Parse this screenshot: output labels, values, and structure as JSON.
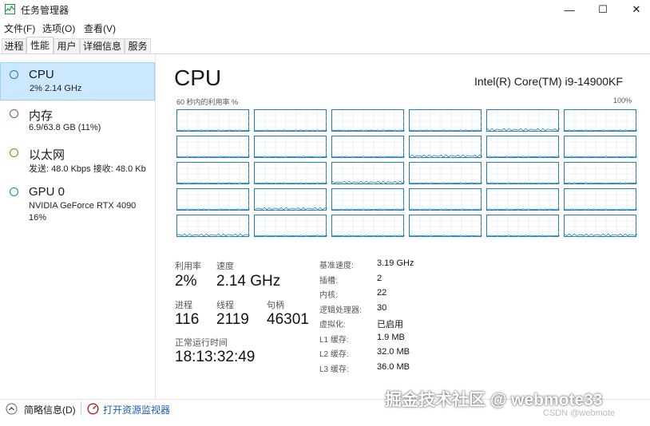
{
  "window": {
    "title": "任务管理器",
    "controls": {
      "minimize": "—",
      "maximize": "☐",
      "close": "✕"
    }
  },
  "menu": [
    "文件(F)",
    "选项(O)",
    "查看(V)"
  ],
  "tabs": [
    "进程",
    "性能",
    "用户",
    "详细信息",
    "服务"
  ],
  "active_tab": "性能",
  "sidebar": {
    "items": [
      {
        "name": "CPU",
        "sub1": "2% 2.14 GHz",
        "sub2": "",
        "ring_color": "#1f7bbf",
        "selected": true
      },
      {
        "name": "内存",
        "sub1": "6.9/63.8 GB (11%)",
        "sub2": "",
        "ring_color": "#8b3fa8",
        "selected": false
      },
      {
        "name": "以太网",
        "sub1": "发送: 48.0 Kbps 接收: 48.0 Kb",
        "sub2": "",
        "ring_color": "#a8721f",
        "selected": false
      },
      {
        "name": "GPU 0",
        "sub1": "NVIDIA GeForce RTX 4090",
        "sub2": "16%",
        "ring_color": "#1f7bbf",
        "selected": false
      }
    ]
  },
  "main": {
    "title": "CPU",
    "model": "Intel(R) Core(TM) i9-14900KF",
    "graph_label": "60 秒内的利用率 %",
    "graph_max": "100%",
    "graph_grid": {
      "rows": 5,
      "cols": 6,
      "line_color": "#1f7bbf"
    },
    "stats": {
      "utilization": {
        "label": "利用率",
        "value": "2%"
      },
      "speed": {
        "label": "速度",
        "value": "2.14 GHz"
      },
      "processes": {
        "label": "进程",
        "value": "116"
      },
      "threads": {
        "label": "线程",
        "value": "2119"
      },
      "handles": {
        "label": "句柄",
        "value": "46301"
      },
      "uptime": {
        "label": "正常运行时间",
        "value": "18:13:32:49"
      }
    },
    "specs": [
      {
        "label": "基准速度:",
        "value": "3.19 GHz"
      },
      {
        "label": "插槽:",
        "value": "2"
      },
      {
        "label": "内核:",
        "value": "22"
      },
      {
        "label": "逻辑处理器:",
        "value": "30"
      },
      {
        "label": "虚拟化:",
        "value": "已启用"
      },
      {
        "label": "L1 缓存:",
        "value": "1.9 MB"
      },
      {
        "label": "L2 缓存:",
        "value": "32.0 MB"
      },
      {
        "label": "L3 缓存:",
        "value": "36.0 MB"
      }
    ]
  },
  "footer": {
    "brief": "简略信息(D)",
    "monitor": "打开资源监视器"
  },
  "watermark": "掘金技术社区 @ webmote33",
  "csdn": "CSDN @webmote"
}
